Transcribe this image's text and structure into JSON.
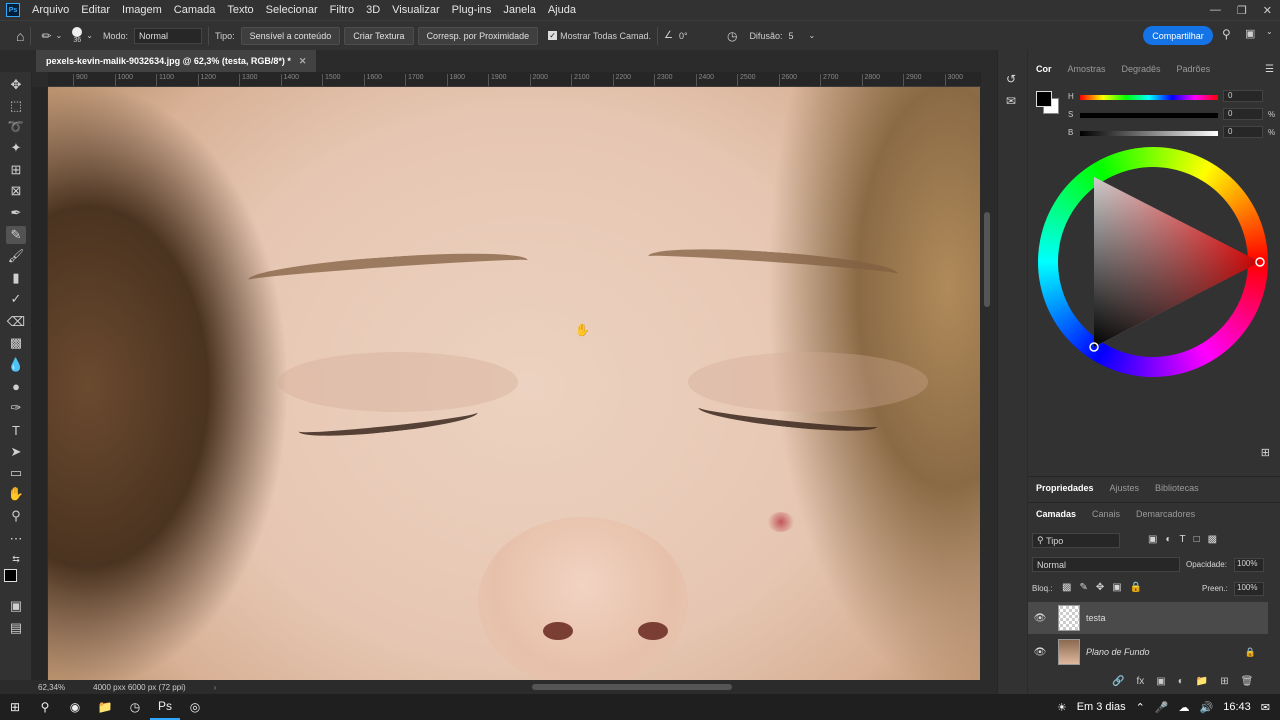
{
  "menu": [
    "Arquivo",
    "Editar",
    "Imagem",
    "Camada",
    "Texto",
    "Selecionar",
    "Filtro",
    "3D",
    "Visualizar",
    "Plug-ins",
    "Janela",
    "Ajuda"
  ],
  "options": {
    "brush_size": "36",
    "mode_label": "Modo:",
    "mode_value": "Normal",
    "type_label": "Tipo:",
    "btn_content_aware": "Sensível a conteúdo",
    "btn_create_texture": "Criar Textura",
    "btn_proximity": "Corresp. por Proximidade",
    "sample_all_layers": "Mostrar Todas Camad.",
    "angle": "0°",
    "diffusion_label": "Difusão:",
    "diffusion_value": "5",
    "share": "Compartilhar"
  },
  "document": {
    "tab_title": "pexels-kevin-malik-9032634.jpg @ 62,3% (testa, RGB/8*) *",
    "ruler_ticks": [
      "900",
      "1000",
      "1100",
      "1200",
      "1300",
      "1400",
      "1500",
      "1600",
      "1700",
      "1800",
      "1900",
      "2000",
      "2100",
      "2200",
      "2300",
      "2400",
      "2500",
      "2600",
      "2700",
      "2800",
      "2900",
      "3000"
    ],
    "zoom": "62,34%",
    "doc_size": "4000 pxx 6000 px (72 ppi)"
  },
  "color_panel": {
    "tabs": [
      "Cor",
      "Amostras",
      "Degradês",
      "Padrões"
    ],
    "h_label": "H",
    "h_value": "0",
    "s_label": "S",
    "s_value": "0",
    "s_unit": "%",
    "b_label": "B",
    "b_value": "0",
    "b_unit": "%"
  },
  "props_tabs": [
    "Propriedades",
    "Ajustes",
    "Bibliotecas"
  ],
  "layers_panel": {
    "tabs": [
      "Camadas",
      "Canais",
      "Demarcadores"
    ],
    "filter": "Tipo",
    "blend_mode": "Normal",
    "opacity_label": "Opacidade:",
    "opacity_value": "100%",
    "lock_label": "Bloq.:",
    "fill_label": "Preen.:",
    "fill_value": "100%",
    "layers": [
      {
        "name": "testa"
      },
      {
        "name": "Plano de Fundo"
      }
    ]
  },
  "taskbar": {
    "weather": "Em 3 dias",
    "time": "16:43"
  }
}
